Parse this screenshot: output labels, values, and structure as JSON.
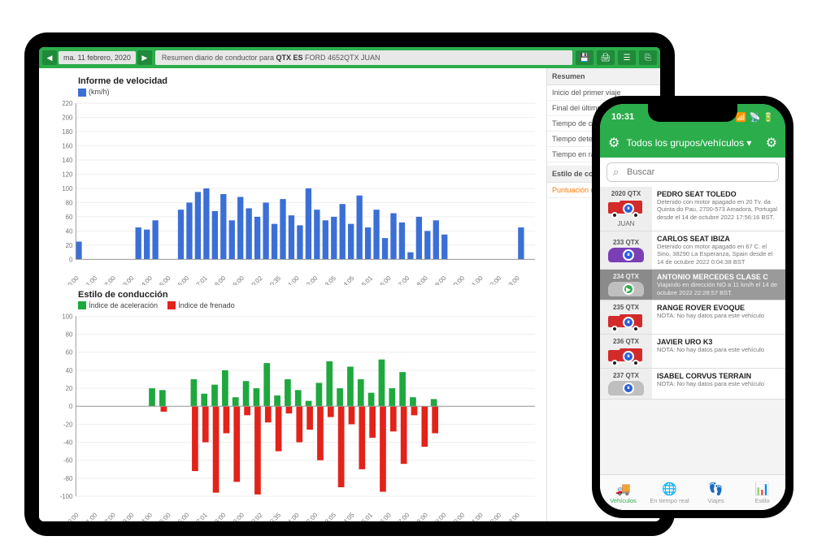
{
  "tablet": {
    "date": "ma. 11 febrero, 2020",
    "title_prefix": "Resumen diario de conductor para ",
    "title_bold": "QTX ES",
    "title_suffix": " FORD 4652QTX JUAN",
    "summary": {
      "header": "Resumen",
      "rows": [
        "Inicio del primer viaje",
        "Final del último viaje",
        "Tiempo de conducci",
        "Tiempo detenido:",
        "Tiempo en ralentí:"
      ],
      "style_header": "Estilo de conducción",
      "score_label": "Puntuación diaria"
    }
  },
  "chart_data": [
    {
      "type": "bar",
      "title": "Informe de velocidad",
      "legend": "(km/h)",
      "ylabel": "km/h",
      "ylim": [
        0,
        220
      ],
      "x_labels": [
        "00:00",
        "01:00",
        "02:00",
        "03:00",
        "04:00",
        "05:00",
        "06:00",
        "07:01",
        "08:00",
        "09:00",
        "10:02",
        "10:35",
        "11:00",
        "12:00",
        "13:05",
        "14:05",
        "15:01",
        "16:00",
        "17:00",
        "18:00",
        "19:00",
        "20:00",
        "21:00",
        "22:00",
        "23:00"
      ],
      "values": [
        25,
        0,
        0,
        0,
        0,
        0,
        0,
        45,
        42,
        55,
        0,
        0,
        70,
        80,
        95,
        100,
        68,
        92,
        55,
        88,
        72,
        60,
        80,
        50,
        85,
        62,
        48,
        100,
        70,
        55,
        60,
        78,
        50,
        90,
        45,
        70,
        30,
        65,
        52,
        10,
        60,
        40,
        55,
        35,
        0,
        0,
        0,
        0,
        0,
        0,
        0,
        0,
        45,
        0
      ]
    },
    {
      "type": "bar",
      "title": "Estilo de conducción",
      "series": [
        {
          "name": "Índice de aceleración",
          "color": "#1ea83e"
        },
        {
          "name": "Índice de frenado",
          "color": "#e2231a"
        }
      ],
      "ylim": [
        -100,
        100
      ],
      "x_labels": [
        "00:00",
        "01:00",
        "02:00",
        "03:00",
        "04:00",
        "05:00",
        "06:00",
        "07:01",
        "08:00",
        "09:00",
        "10:02",
        "10:35",
        "11:00",
        "12:00",
        "13:05",
        "14:05",
        "15:01",
        "16:00",
        "17:00",
        "18:00",
        "19:00",
        "20:00",
        "21:00",
        "22:00",
        "23:00"
      ],
      "accel": [
        0,
        0,
        0,
        0,
        0,
        0,
        0,
        20,
        18,
        0,
        0,
        30,
        14,
        24,
        40,
        10,
        28,
        20,
        48,
        12,
        30,
        18,
        6,
        26,
        50,
        20,
        44,
        30,
        15,
        52,
        20,
        38,
        10,
        0,
        8,
        0,
        0,
        0,
        0,
        0,
        0,
        0,
        0,
        0
      ],
      "brake": [
        0,
        0,
        0,
        0,
        0,
        0,
        0,
        0,
        -6,
        0,
        0,
        -72,
        -40,
        -96,
        -30,
        -84,
        -10,
        -98,
        -18,
        -50,
        -8,
        -40,
        -26,
        -60,
        -12,
        -90,
        -20,
        -70,
        -35,
        -95,
        -28,
        -64,
        -10,
        -45,
        -30,
        0,
        0,
        0,
        0,
        0,
        0,
        0,
        0,
        0
      ]
    }
  ],
  "phone": {
    "time": "10:31",
    "group_label": "Todos los grupos/vehículos",
    "search_placeholder": "Buscar",
    "vehicles": [
      {
        "plate": "2020 QTX",
        "name": "PEDRO SEAT TOLEDO",
        "meta": "Detenido con motor apagado en 20 Tv. da Quinta do Pau, 2700-573 Amadora, Portugal desde el 14 de octubre 2022 17:56:16 BST.",
        "driver": "JUAN",
        "color": "red",
        "type": "truck",
        "status": "stop"
      },
      {
        "plate": "233 QTX",
        "name": "CARLOS SEAT IBIZA",
        "meta": "Detenido con motor apagado en 67 C. el Sino, 38290 La Esperanza, Spain desde el 14 de octubre 2022 0:04:38 BST",
        "color": "purple",
        "type": "car",
        "status": "stop"
      },
      {
        "plate": "234 QTX",
        "name": "ANTONIO MERCEDES CLASE C",
        "meta": "Viajando en dirección NO a 11 km/h el 14 de octubre 2022 22:28:57 BST.",
        "color": "grey",
        "type": "car",
        "status": "go",
        "selected": true
      },
      {
        "plate": "235 QTX",
        "name": "RANGE ROVER EVOQUE",
        "meta": "NOTA: No hay datos para este vehículo",
        "color": "red",
        "type": "truck",
        "status": "stop"
      },
      {
        "plate": "236 QTX",
        "name": "JAVIER URO K3",
        "meta": "NOTA: No hay datos para este vehículo",
        "color": "red",
        "type": "truck",
        "status": "stop"
      },
      {
        "plate": "237 QTX",
        "name": "ISABEL CORVUS TERRAIN",
        "meta": "NOTA: No hay datos para este vehículo",
        "color": "grey",
        "type": "car",
        "status": "stop"
      }
    ],
    "tabs": [
      {
        "label": "Vehículos",
        "icon": "🚚",
        "active": true
      },
      {
        "label": "En tiempo real",
        "icon": "🌐"
      },
      {
        "label": "Viajes",
        "icon": "👣"
      },
      {
        "label": "Estilo",
        "icon": "📊"
      }
    ]
  }
}
